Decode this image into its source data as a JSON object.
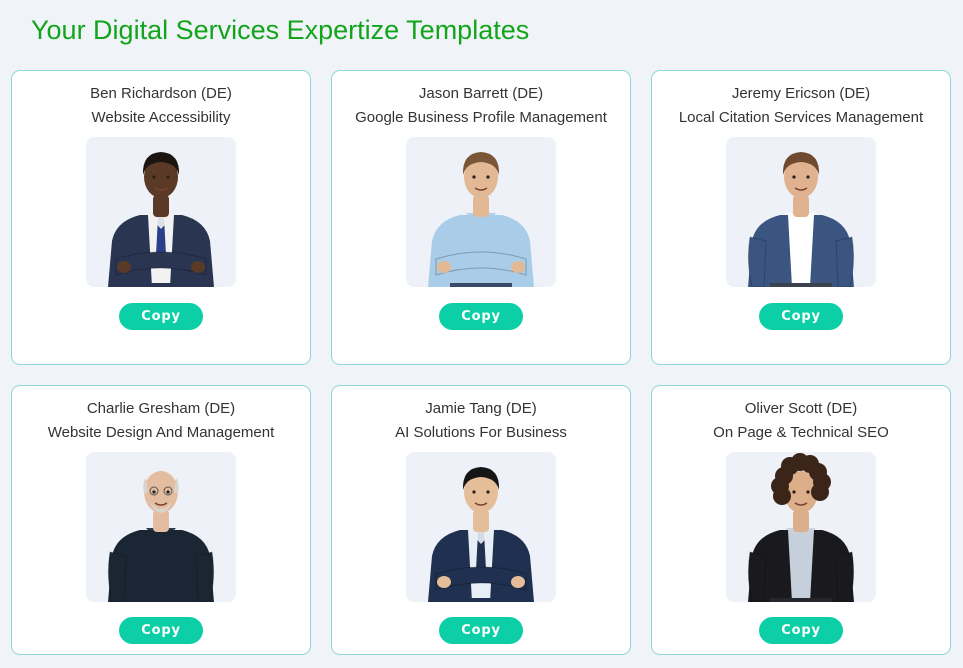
{
  "page": {
    "title": "Your Digital Services Expertize Templates"
  },
  "colors": {
    "title": "#12a51b",
    "card_border": "#8fd6d8",
    "button": "#0ccfa8",
    "background": "#f0f4f8",
    "portrait_bg": "#eef2f8"
  },
  "cards": [
    {
      "name": "Ben Richardson (DE)",
      "service": "Website Accessibility",
      "portrait": {
        "skin": "#5a3a27",
        "hair": "#1b1410",
        "hair_style": "short",
        "top": "#2a3552",
        "shirt": "#f2f2f2",
        "tie": "#2a3f8a",
        "pants": "#2a3552",
        "arms": "crossed"
      },
      "button_label": "Copy"
    },
    {
      "name": "Jason Barrett (DE)",
      "service": "Google Business Profile Management",
      "portrait": {
        "skin": "#e2b895",
        "hair": "#7a5536",
        "hair_style": "short",
        "top": "#a9cde8",
        "shirt": "#a9cde8",
        "tie": "",
        "pants": "#3a4a66",
        "arms": "crossed"
      },
      "button_label": "Copy"
    },
    {
      "name": "Jeremy Ericson (DE)",
      "service": "Local Citation Services Management",
      "portrait": {
        "skin": "#e0b290",
        "hair": "#6f4a30",
        "hair_style": "short",
        "top": "#3a5580",
        "shirt": "#ffffff",
        "tie": "",
        "pants": "#3a4250",
        "arms": "down"
      },
      "button_label": "Copy"
    },
    {
      "name": "Charlie Gresham (DE)",
      "service": "Website Design And Management",
      "portrait": {
        "skin": "#e4bca0",
        "hair": "#d8d4cf",
        "hair_style": "bald",
        "top": "#1b2635",
        "shirt": "#1b2635",
        "tie": "",
        "pants": "#1b2635",
        "arms": "down"
      },
      "button_label": "Copy"
    },
    {
      "name": "Jamie Tang (DE)",
      "service": "AI Solutions For Business",
      "portrait": {
        "skin": "#e5bd98",
        "hair": "#151515",
        "hair_style": "short",
        "top": "#1f3050",
        "shirt": "#e8eef5",
        "tie": "#1f3050",
        "pants": "#1f3050",
        "arms": "crossed"
      },
      "button_label": "Copy"
    },
    {
      "name": "Oliver Scott (DE)",
      "service": "On Page & Technical SEO",
      "portrait": {
        "skin": "#dcae8a",
        "hair": "#3a2518",
        "hair_style": "curly",
        "top": "#1a1a1e",
        "shirt": "#c6d0dc",
        "tie": "",
        "pants": "#25272d",
        "arms": "down"
      },
      "button_label": "Copy"
    }
  ]
}
